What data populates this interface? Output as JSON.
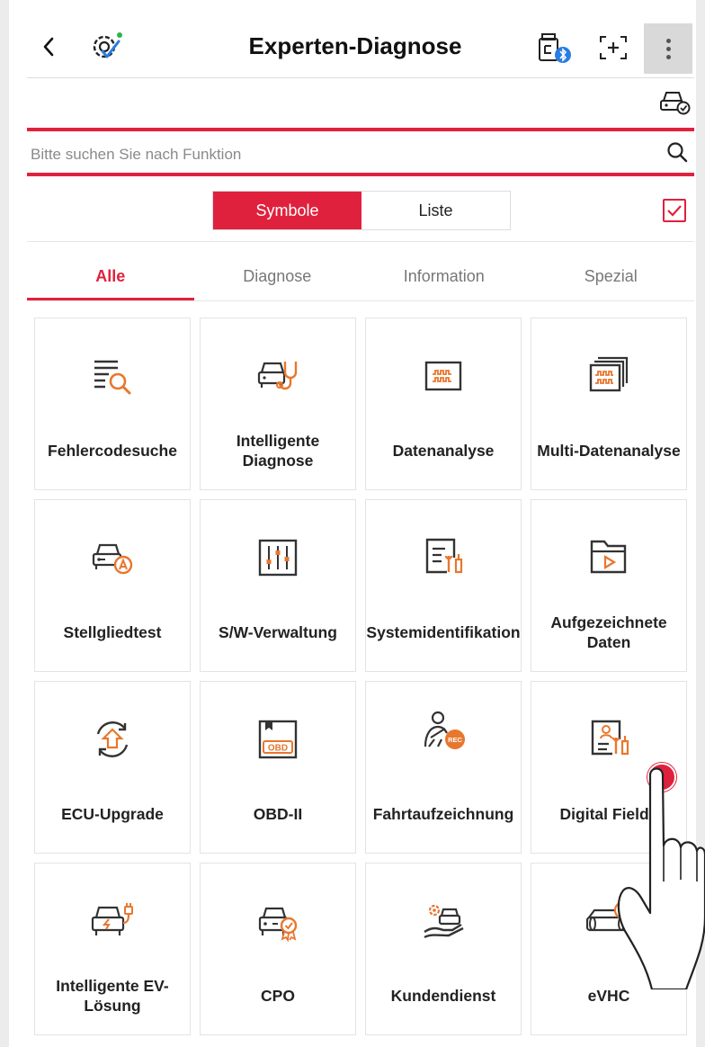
{
  "header": {
    "title": "Experten-Diagnose",
    "icons": [
      "back-icon",
      "app-settings-icon",
      "vci-bluetooth-icon",
      "screen-capture-icon",
      "more-vertical-icon",
      "car-check-icon"
    ]
  },
  "search": {
    "placeholder": "Bitte suchen Sie nach Funktion"
  },
  "view_toggle": {
    "options": [
      "Symbole",
      "Liste"
    ],
    "selected": "Symbole",
    "checkbox_checked": true
  },
  "tabs": [
    {
      "label": "Alle",
      "active": true
    },
    {
      "label": "Diagnose",
      "active": false
    },
    {
      "label": "Information",
      "active": false
    },
    {
      "label": "Spezial",
      "active": false
    }
  ],
  "tiles": [
    {
      "label": "Fehlercodesuche",
      "icon": "dtc-search-icon"
    },
    {
      "label": "Intelligente Diagnose",
      "icon": "smart-diagnosis-icon"
    },
    {
      "label": "Datenanalyse",
      "icon": "data-analysis-icon"
    },
    {
      "label": "Multi-Datenanalyse",
      "icon": "multi-data-analysis-icon"
    },
    {
      "label": "Stellgliedtest",
      "icon": "actuation-test-icon"
    },
    {
      "label": "S/W-Verwaltung",
      "icon": "software-management-icon"
    },
    {
      "label": "Systemidentifikation",
      "icon": "system-identification-icon"
    },
    {
      "label": "Aufgezeichnete Daten",
      "icon": "recorded-data-icon"
    },
    {
      "label": "ECU-Upgrade",
      "icon": "ecu-upgrade-icon"
    },
    {
      "label": "OBD-II",
      "icon": "obd-ii-icon"
    },
    {
      "label": "Fahrtaufzeichnung",
      "icon": "drive-recording-icon"
    },
    {
      "label": "Digital Field I",
      "icon": "digital-field-icon"
    },
    {
      "label": "Intelligente EV-Lösung",
      "icon": "ev-solution-icon"
    },
    {
      "label": "CPO",
      "icon": "cpo-icon"
    },
    {
      "label": "Kundendienst",
      "icon": "customer-service-icon"
    },
    {
      "label": "eVHC",
      "icon": "evhc-icon"
    }
  ],
  "colors": {
    "accent": "#e0213d",
    "icon_orange": "#e8772e",
    "icon_dark": "#333333"
  }
}
